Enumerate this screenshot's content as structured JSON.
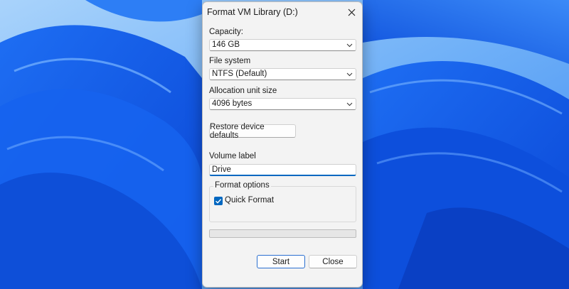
{
  "dialog": {
    "title": "Format VM Library (D:)",
    "capacity": {
      "label": "Capacity:",
      "value": "146 GB"
    },
    "file_system": {
      "label": "File system",
      "value": "NTFS (Default)"
    },
    "allocation": {
      "label": "Allocation unit size",
      "value": "4096 bytes"
    },
    "restore_label": "Restore device defaults",
    "volume_label": {
      "label": "Volume label",
      "value": "Drive"
    },
    "format_options": {
      "legend": "Format options",
      "quick_format": {
        "label": "Quick Format",
        "checked": true
      }
    },
    "progress": {
      "value": 0
    },
    "start_label": "Start",
    "close_label": "Close"
  },
  "colors": {
    "accent": "#0067c0",
    "wallpaper": "#2f78f2",
    "dialog_bg": "#f3f3f3"
  },
  "icons": {
    "close": "close-icon",
    "chevron": "chevron-down-icon",
    "check": "checkmark-icon"
  }
}
